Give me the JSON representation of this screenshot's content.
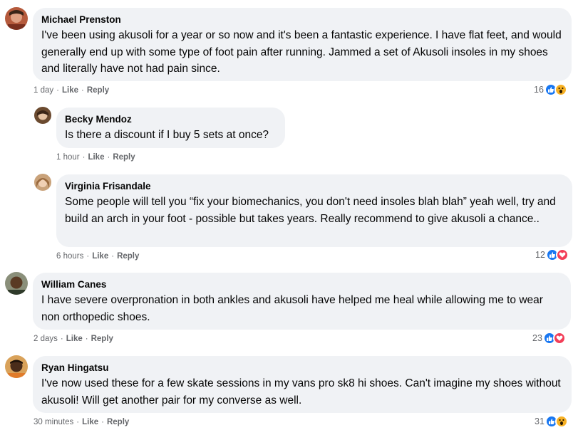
{
  "colors": {
    "like_blue": "#1877f2",
    "love_red": "#f33e58",
    "wow_yellow": "#f7b125",
    "bubble_bg": "#f0f2f5",
    "meta_gray": "#65676b"
  },
  "comments": [
    {
      "author": "Michael Prenston",
      "text": "I've been using akusoli for a year or so now and it's been a fantastic experience. I have flat feet, and would generally end up with some type of foot pain after running. Jammed a set of Akusoli insoles in my shoes and literally have not had pain since.",
      "time": "1 day",
      "like": "Like",
      "reply": "Reply",
      "reaction_count": "16",
      "reactions": [
        "like-icon",
        "wow-icon"
      ]
    },
    {
      "author": "Becky Mendoz",
      "text": "Is there a discount if I buy 5 sets at once?",
      "time": "1 hour",
      "like": "Like",
      "reply": "Reply"
    },
    {
      "author": "Virginia Frisandale",
      "text": "Some people will tell you “fix your biomechanics, you don't need insoles blah blah” yeah well, try and build an arch in your foot - possible but takes years. Really recommend to give akusoli a chance..",
      "time": "6 hours",
      "like": "Like",
      "reply": "Reply",
      "reaction_count": "12",
      "reactions": [
        "like-icon",
        "love-icon"
      ]
    },
    {
      "author": "William Canes",
      "text": "I have severe overpronation in both ankles and akusoli have helped me heal while allowing me to wear non orthopedic shoes.",
      "time": "2 days",
      "like": "Like",
      "reply": "Reply",
      "reaction_count": "23",
      "reactions": [
        "like-icon",
        "love-icon"
      ]
    },
    {
      "author": "Ryan Hingatsu",
      "text": "I've now used these for a few skate sessions in my vans pro sk8 hi shoes. Can't imagine my shoes without akusoli! Will get another pair for my converse as well.",
      "time": "30 minutes",
      "like": "Like",
      "reply": "Reply",
      "reaction_count": "31",
      "reactions": [
        "like-icon",
        "wow-icon"
      ]
    }
  ]
}
